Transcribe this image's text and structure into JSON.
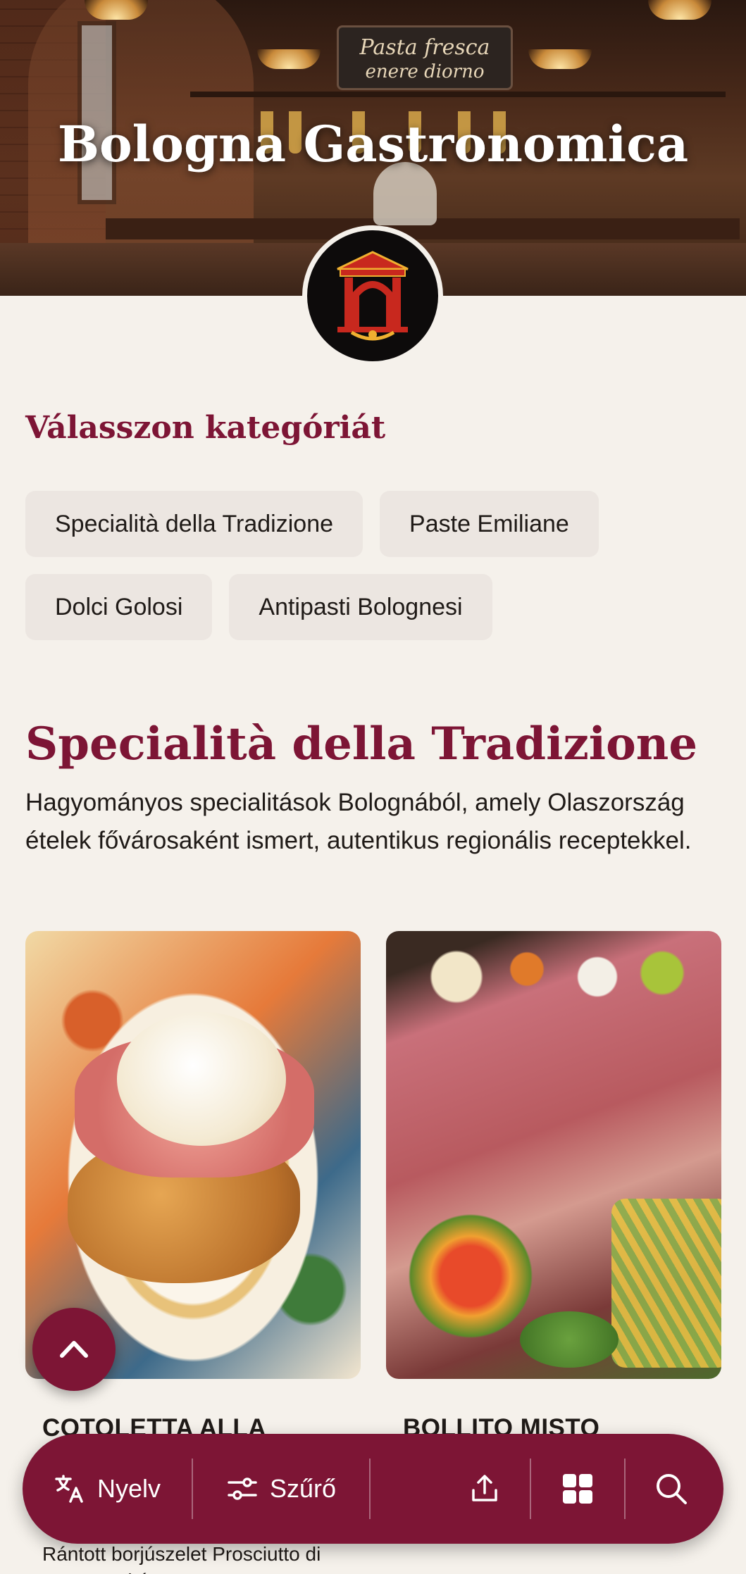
{
  "hero": {
    "title": "Bologna Gastronomica",
    "sign_line1": "Pasta fresca",
    "sign_line2": "enere diorno"
  },
  "categories": {
    "heading": "Válasszon kategóriát",
    "items": [
      {
        "label": "Specialità della Tradizione"
      },
      {
        "label": "Paste Emiliane"
      },
      {
        "label": "Dolci Golosi"
      },
      {
        "label": "Antipasti Bolognesi"
      }
    ]
  },
  "section": {
    "title": "Specialità della Tradizione",
    "description": "Hagyományos specialitások Bolognából, amely Olaszország ételek fővárosaként ismert, autentikus regionális receptekkel."
  },
  "cards": [
    {
      "title": "COTOLETTA ALLA",
      "description": "Rántott borjúszelet Prosciutto di Parma-val és..."
    },
    {
      "title": "BOLLITO MISTO"
    }
  ],
  "bottom_bar": {
    "language_label": "Nyelv",
    "filter_label": "Szűrő"
  },
  "colors": {
    "accent": "#7d1535",
    "background": "#f5f1eb",
    "chip_bg": "#ece6e1"
  },
  "icons": {
    "language": "translate-icon",
    "filter": "sliders-icon",
    "share": "share-upload-icon",
    "grid": "grid-icon",
    "search": "search-icon",
    "scroll_top": "chevron-up-icon"
  }
}
